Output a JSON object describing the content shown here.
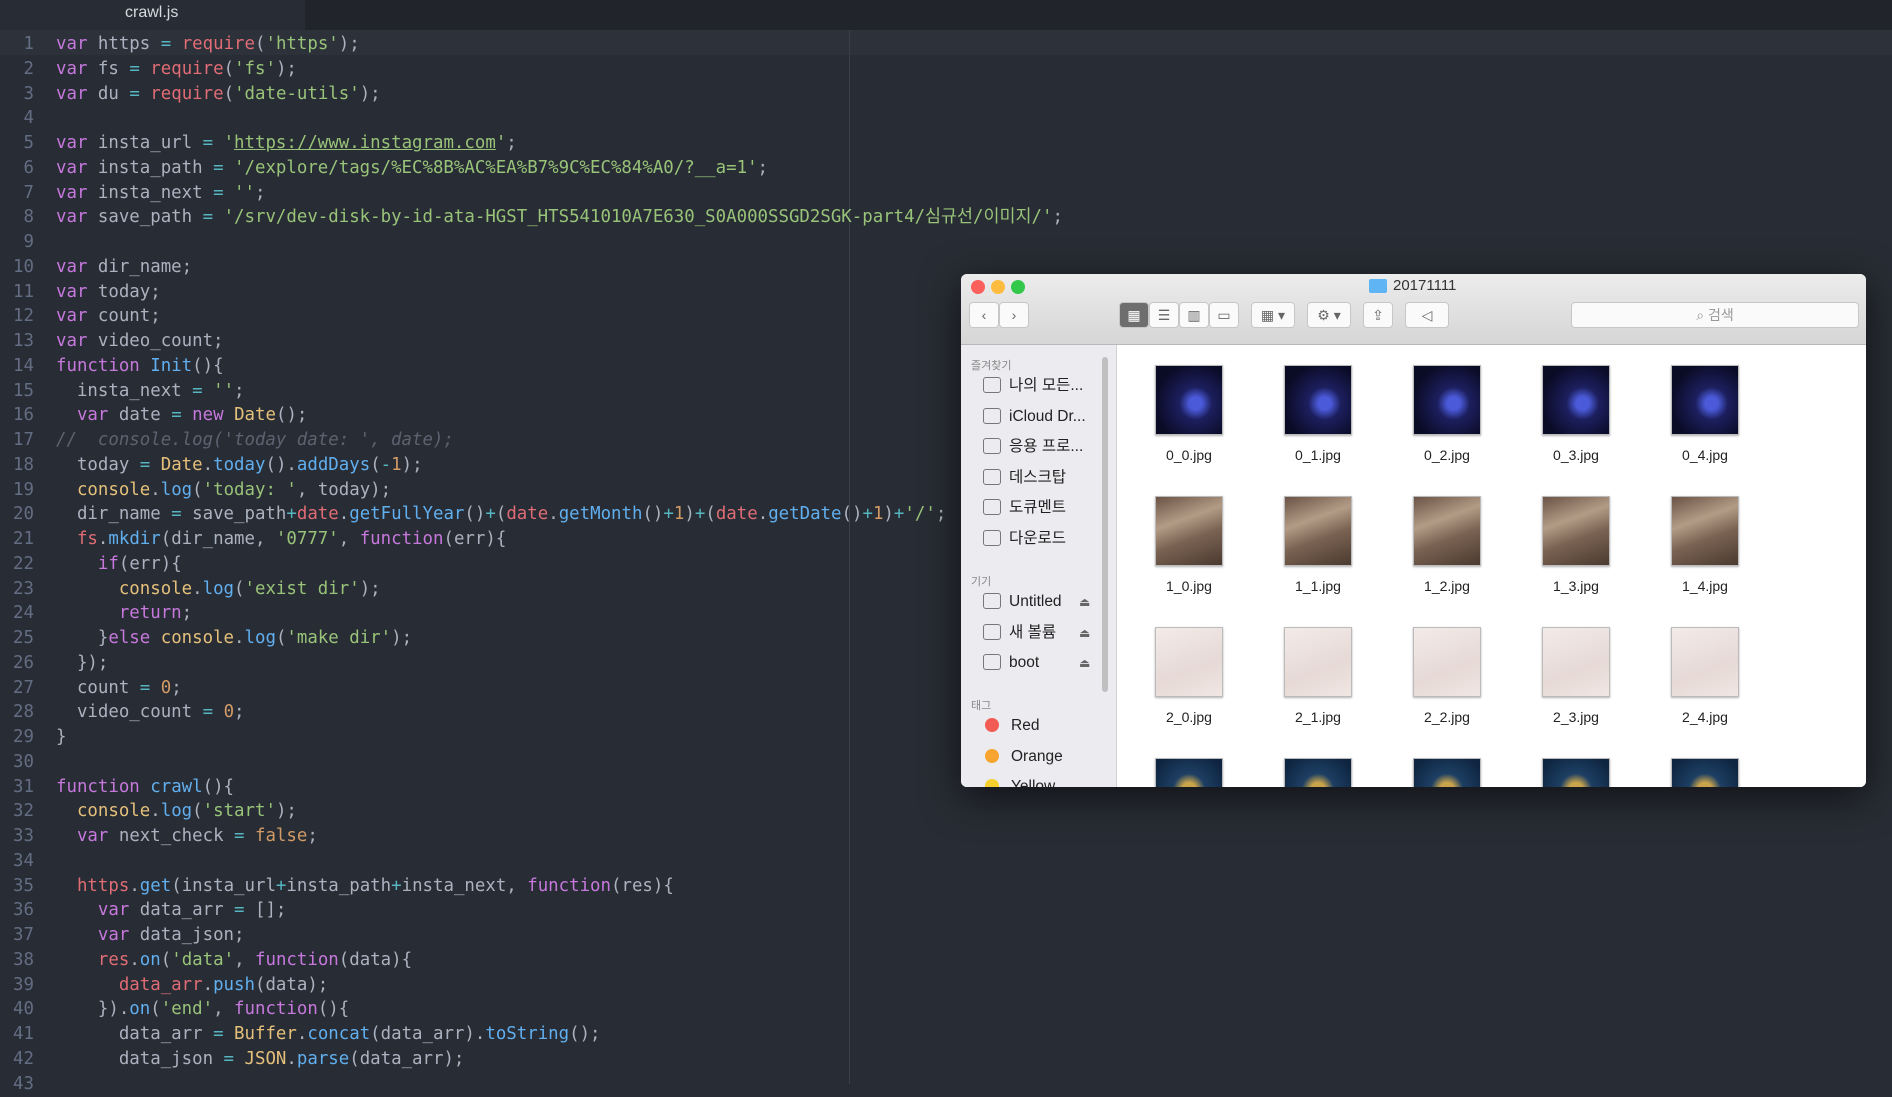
{
  "editor": {
    "tab_title": "crawl.js",
    "lines": [
      [
        [
          "k",
          "var"
        ],
        [
          "p",
          " https "
        ],
        [
          "o",
          "="
        ],
        [
          "p",
          " "
        ],
        [
          "r",
          "require"
        ],
        [
          "p",
          "("
        ],
        [
          "s",
          "'https'"
        ],
        [
          "p",
          ");"
        ]
      ],
      [
        [
          "k",
          "var"
        ],
        [
          "p",
          " fs "
        ],
        [
          "o",
          "="
        ],
        [
          "p",
          " "
        ],
        [
          "r",
          "require"
        ],
        [
          "p",
          "("
        ],
        [
          "s",
          "'fs'"
        ],
        [
          "p",
          ");"
        ]
      ],
      [
        [
          "k",
          "var"
        ],
        [
          "p",
          " du "
        ],
        [
          "o",
          "="
        ],
        [
          "p",
          " "
        ],
        [
          "r",
          "require"
        ],
        [
          "p",
          "("
        ],
        [
          "s",
          "'date-utils'"
        ],
        [
          "p",
          ");"
        ]
      ],
      [],
      [
        [
          "k",
          "var"
        ],
        [
          "p",
          " insta_url "
        ],
        [
          "o",
          "="
        ],
        [
          "p",
          " "
        ],
        [
          "s",
          "'"
        ],
        [
          "u",
          "https://www.instagram.com"
        ],
        [
          "s",
          "'"
        ],
        [
          "p",
          ";"
        ]
      ],
      [
        [
          "k",
          "var"
        ],
        [
          "p",
          " insta_path "
        ],
        [
          "o",
          "="
        ],
        [
          "p",
          " "
        ],
        [
          "s",
          "'/explore/tags/%EC%8B%AC%EA%B7%9C%EC%84%A0/?__a=1'"
        ],
        [
          "p",
          ";"
        ]
      ],
      [
        [
          "k",
          "var"
        ],
        [
          "p",
          " insta_next "
        ],
        [
          "o",
          "="
        ],
        [
          "p",
          " "
        ],
        [
          "s",
          "''"
        ],
        [
          "p",
          ";"
        ]
      ],
      [
        [
          "k",
          "var"
        ],
        [
          "p",
          " save_path "
        ],
        [
          "o",
          "="
        ],
        [
          "p",
          " "
        ],
        [
          "s",
          "'/srv/dev-disk-by-id-ata-HGST_HTS541010A7E630_S0A000SSGD2SGK-part4/심규선/이미지/'"
        ],
        [
          "p",
          ";"
        ]
      ],
      [],
      [
        [
          "k",
          "var"
        ],
        [
          "p",
          " dir_name;"
        ]
      ],
      [
        [
          "k",
          "var"
        ],
        [
          "p",
          " today;"
        ]
      ],
      [
        [
          "k",
          "var"
        ],
        [
          "p",
          " count;"
        ]
      ],
      [
        [
          "k",
          "var"
        ],
        [
          "p",
          " video_count;"
        ]
      ],
      [
        [
          "k",
          "function"
        ],
        [
          "p",
          " "
        ],
        [
          "f",
          "Init"
        ],
        [
          "p",
          "(){"
        ]
      ],
      [
        [
          "p",
          "  insta_next "
        ],
        [
          "o",
          "="
        ],
        [
          "p",
          " "
        ],
        [
          "s",
          "''"
        ],
        [
          "p",
          ";"
        ]
      ],
      [
        [
          "p",
          "  "
        ],
        [
          "k",
          "var"
        ],
        [
          "p",
          " date "
        ],
        [
          "o",
          "="
        ],
        [
          "p",
          " "
        ],
        [
          "k",
          "new"
        ],
        [
          "p",
          " "
        ],
        [
          "t",
          "Date"
        ],
        [
          "p",
          "();"
        ]
      ],
      [
        [
          "c",
          "//  console.log('today date: ', date);"
        ]
      ],
      [
        [
          "p",
          "  today "
        ],
        [
          "o",
          "="
        ],
        [
          "p",
          " "
        ],
        [
          "t",
          "Date"
        ],
        [
          "p",
          "."
        ],
        [
          "f",
          "today"
        ],
        [
          "p",
          "()."
        ],
        [
          "f",
          "addDays"
        ],
        [
          "p",
          "("
        ],
        [
          "o",
          "-"
        ],
        [
          "n",
          "1"
        ],
        [
          "p",
          ");"
        ]
      ],
      [
        [
          "p",
          "  "
        ],
        [
          "t",
          "console"
        ],
        [
          "p",
          "."
        ],
        [
          "f",
          "log"
        ],
        [
          "p",
          "("
        ],
        [
          "s",
          "'today: '"
        ],
        [
          "p",
          ", today);"
        ]
      ],
      [
        [
          "p",
          "  dir_name "
        ],
        [
          "o",
          "="
        ],
        [
          "p",
          " save_path"
        ],
        [
          "o",
          "+"
        ],
        [
          "r",
          "date"
        ],
        [
          "p",
          "."
        ],
        [
          "f",
          "getFullYear"
        ],
        [
          "p",
          "()"
        ],
        [
          "o",
          "+"
        ],
        [
          "p",
          "("
        ],
        [
          "r",
          "date"
        ],
        [
          "p",
          "."
        ],
        [
          "f",
          "getMonth"
        ],
        [
          "p",
          "()"
        ],
        [
          "o",
          "+"
        ],
        [
          "n",
          "1"
        ],
        [
          "p",
          ")"
        ],
        [
          "o",
          "+"
        ],
        [
          "p",
          "("
        ],
        [
          "r",
          "date"
        ],
        [
          "p",
          "."
        ],
        [
          "f",
          "getDate"
        ],
        [
          "p",
          "()"
        ],
        [
          "o",
          "+"
        ],
        [
          "n",
          "1"
        ],
        [
          "p",
          ")"
        ],
        [
          "o",
          "+"
        ],
        [
          "s",
          "'/'"
        ],
        [
          "p",
          ";"
        ]
      ],
      [
        [
          "p",
          "  "
        ],
        [
          "r",
          "fs"
        ],
        [
          "p",
          "."
        ],
        [
          "f",
          "mkdir"
        ],
        [
          "p",
          "(dir_name, "
        ],
        [
          "s",
          "'0777'"
        ],
        [
          "p",
          ", "
        ],
        [
          "k",
          "function"
        ],
        [
          "p",
          "(err){"
        ]
      ],
      [
        [
          "p",
          "    "
        ],
        [
          "k",
          "if"
        ],
        [
          "p",
          "(err){"
        ]
      ],
      [
        [
          "p",
          "      "
        ],
        [
          "t",
          "console"
        ],
        [
          "p",
          "."
        ],
        [
          "f",
          "log"
        ],
        [
          "p",
          "("
        ],
        [
          "s",
          "'exist dir'"
        ],
        [
          "p",
          ");"
        ]
      ],
      [
        [
          "p",
          "      "
        ],
        [
          "k",
          "return"
        ],
        [
          "p",
          ";"
        ]
      ],
      [
        [
          "p",
          "    }"
        ],
        [
          "k",
          "else"
        ],
        [
          "p",
          " "
        ],
        [
          "t",
          "console"
        ],
        [
          "p",
          "."
        ],
        [
          "f",
          "log"
        ],
        [
          "p",
          "("
        ],
        [
          "s",
          "'make dir'"
        ],
        [
          "p",
          ");"
        ]
      ],
      [
        [
          "p",
          "  });"
        ]
      ],
      [
        [
          "p",
          "  count "
        ],
        [
          "o",
          "="
        ],
        [
          "p",
          " "
        ],
        [
          "n",
          "0"
        ],
        [
          "p",
          ";"
        ]
      ],
      [
        [
          "p",
          "  video_count "
        ],
        [
          "o",
          "="
        ],
        [
          "p",
          " "
        ],
        [
          "n",
          "0"
        ],
        [
          "p",
          ";"
        ]
      ],
      [
        [
          "p",
          "}"
        ]
      ],
      [],
      [
        [
          "k",
          "function"
        ],
        [
          "p",
          " "
        ],
        [
          "f",
          "crawl"
        ],
        [
          "p",
          "(){"
        ]
      ],
      [
        [
          "p",
          "  "
        ],
        [
          "t",
          "console"
        ],
        [
          "p",
          "."
        ],
        [
          "f",
          "log"
        ],
        [
          "p",
          "("
        ],
        [
          "s",
          "'start'"
        ],
        [
          "p",
          ");"
        ]
      ],
      [
        [
          "p",
          "  "
        ],
        [
          "k",
          "var"
        ],
        [
          "p",
          " next_check "
        ],
        [
          "o",
          "="
        ],
        [
          "p",
          " "
        ],
        [
          "n",
          "false"
        ],
        [
          "p",
          ";"
        ]
      ],
      [],
      [
        [
          "p",
          "  "
        ],
        [
          "r",
          "https"
        ],
        [
          "p",
          "."
        ],
        [
          "f",
          "get"
        ],
        [
          "p",
          "(insta_url"
        ],
        [
          "o",
          "+"
        ],
        [
          "p",
          "insta_path"
        ],
        [
          "o",
          "+"
        ],
        [
          "p",
          "insta_next, "
        ],
        [
          "k",
          "function"
        ],
        [
          "p",
          "(res){"
        ]
      ],
      [
        [
          "p",
          "    "
        ],
        [
          "k",
          "var"
        ],
        [
          "p",
          " data_arr "
        ],
        [
          "o",
          "="
        ],
        [
          "p",
          " [];"
        ]
      ],
      [
        [
          "p",
          "    "
        ],
        [
          "k",
          "var"
        ],
        [
          "p",
          " data_json;"
        ]
      ],
      [
        [
          "p",
          "    "
        ],
        [
          "r",
          "res"
        ],
        [
          "p",
          "."
        ],
        [
          "f",
          "on"
        ],
        [
          "p",
          "("
        ],
        [
          "s",
          "'data'"
        ],
        [
          "p",
          ", "
        ],
        [
          "k",
          "function"
        ],
        [
          "p",
          "(data){"
        ]
      ],
      [
        [
          "p",
          "      "
        ],
        [
          "r",
          "data_arr"
        ],
        [
          "p",
          "."
        ],
        [
          "f",
          "push"
        ],
        [
          "p",
          "(data);"
        ]
      ],
      [
        [
          "p",
          "    })."
        ],
        [
          "f",
          "on"
        ],
        [
          "p",
          "("
        ],
        [
          "s",
          "'end'"
        ],
        [
          "p",
          ", "
        ],
        [
          "k",
          "function"
        ],
        [
          "p",
          "(){"
        ]
      ],
      [
        [
          "p",
          "      data_arr "
        ],
        [
          "o",
          "="
        ],
        [
          "p",
          " "
        ],
        [
          "t",
          "Buffer"
        ],
        [
          "p",
          "."
        ],
        [
          "f",
          "concat"
        ],
        [
          "p",
          "(data_arr)."
        ],
        [
          "f",
          "toString"
        ],
        [
          "p",
          "();"
        ]
      ],
      [
        [
          "p",
          "      data_json "
        ],
        [
          "o",
          "="
        ],
        [
          "p",
          " "
        ],
        [
          "t",
          "JSON"
        ],
        [
          "p",
          "."
        ],
        [
          "f",
          "parse"
        ],
        [
          "p",
          "(data_arr);"
        ]
      ],
      []
    ]
  },
  "finder": {
    "title": "20171111",
    "search_placeholder": "검색",
    "sidebar": {
      "favorites_header": "즐겨찾기",
      "favorites": [
        {
          "label": "나의 모든...",
          "icon": "all-files-icon"
        },
        {
          "label": "iCloud Dr...",
          "icon": "cloud-icon"
        },
        {
          "label": "응용 프로...",
          "icon": "applications-icon"
        },
        {
          "label": "데스크탑",
          "icon": "desktop-icon"
        },
        {
          "label": "도큐멘트",
          "icon": "documents-icon"
        },
        {
          "label": "다운로드",
          "icon": "downloads-icon"
        }
      ],
      "devices_header": "기기",
      "devices": [
        {
          "label": "Untitled",
          "icon": "disk-icon"
        },
        {
          "label": "새 볼륨",
          "icon": "disk-icon"
        },
        {
          "label": "boot",
          "icon": "disk-icon"
        }
      ],
      "tags_header": "태그",
      "tags": [
        {
          "label": "Red",
          "color": "#f25c54"
        },
        {
          "label": "Orange",
          "color": "#f7a530"
        },
        {
          "label": "Yellow",
          "color": "#f5cf2c"
        }
      ]
    },
    "files": [
      [
        "0_0.jpg",
        "0_1.jpg",
        "0_2.jpg",
        "0_3.jpg",
        "0_4.jpg"
      ],
      [
        "1_0.jpg",
        "1_1.jpg",
        "1_2.jpg",
        "1_3.jpg",
        "1_4.jpg"
      ],
      [
        "2_0.jpg",
        "2_1.jpg",
        "2_2.jpg",
        "2_3.jpg",
        "2_4.jpg"
      ],
      [
        "",
        "",
        "",
        "",
        ""
      ]
    ],
    "thumb_styles": [
      "concert",
      "event",
      "paper",
      "poster"
    ]
  }
}
